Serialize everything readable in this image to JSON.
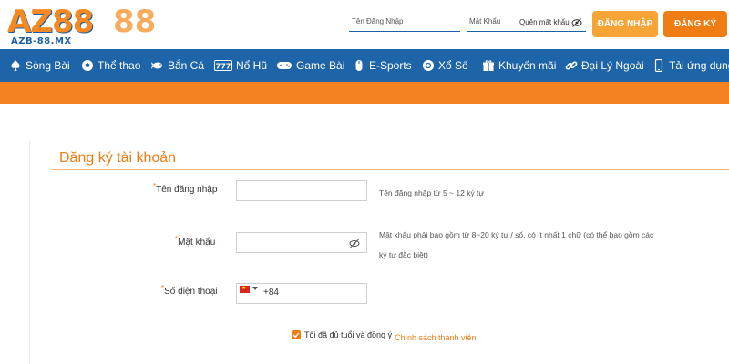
{
  "header": {
    "logo_text": "AZ88",
    "logo_ghost": "88",
    "logo_sub": "AZB-88.MX",
    "username_placeholder": "Tên Đăng Nhập",
    "password_placeholder": "Mật Khẩu",
    "forgot_password": "Quên mật khẩu",
    "login_button": "ĐĂNG NHẬP",
    "register_button": "ĐĂNG KÝ"
  },
  "nav": {
    "items": [
      {
        "label": "Sòng Bài",
        "icon": "spade-icon"
      },
      {
        "label": "Thể thao",
        "icon": "soccer-ball-icon"
      },
      {
        "label": "Bắn Cá",
        "icon": "fish-icon"
      },
      {
        "label": "Nổ Hũ",
        "icon": "slot-777-icon"
      },
      {
        "label": "Game Bài",
        "icon": "gamepad-icon"
      },
      {
        "label": "E-Sports",
        "icon": "mouse-icon"
      },
      {
        "label": "Xổ Số",
        "icon": "lottery-ball-icon"
      },
      {
        "label": "Khuyến mãi",
        "icon": "gift-icon"
      },
      {
        "label": "Đại Lý Ngoài",
        "icon": "link-icon"
      },
      {
        "label": "Tải ứng dụng",
        "icon": "phone-icon"
      }
    ]
  },
  "form": {
    "title": "Đăng ký tài khoản",
    "username": {
      "label": "Tên đăng nhập",
      "value": "",
      "hint": "Tên đăng nhập từ 5 ~ 12 ký tự"
    },
    "password": {
      "label": "Mật khẩu",
      "value": "",
      "hint_line1": "Mật khẩu phải bao gồm từ 8~20 ký tự / số, có ít nhất 1 chữ (có thể bao gồm các",
      "hint_line2": "ký tự đặc biệt)"
    },
    "phone": {
      "label": "Số điện thoại",
      "country_code": "+84"
    },
    "required_mark": "*",
    "colon": ":",
    "agree_text": "Tôi đã đủ tuổi và đồng ý",
    "policy_link": "Chính sách thành viên"
  },
  "colors": {
    "primary_blue": "#1e64a8",
    "accent_orange": "#f58220",
    "login_orange": "#f7a436",
    "register_orange": "#f07c14"
  }
}
